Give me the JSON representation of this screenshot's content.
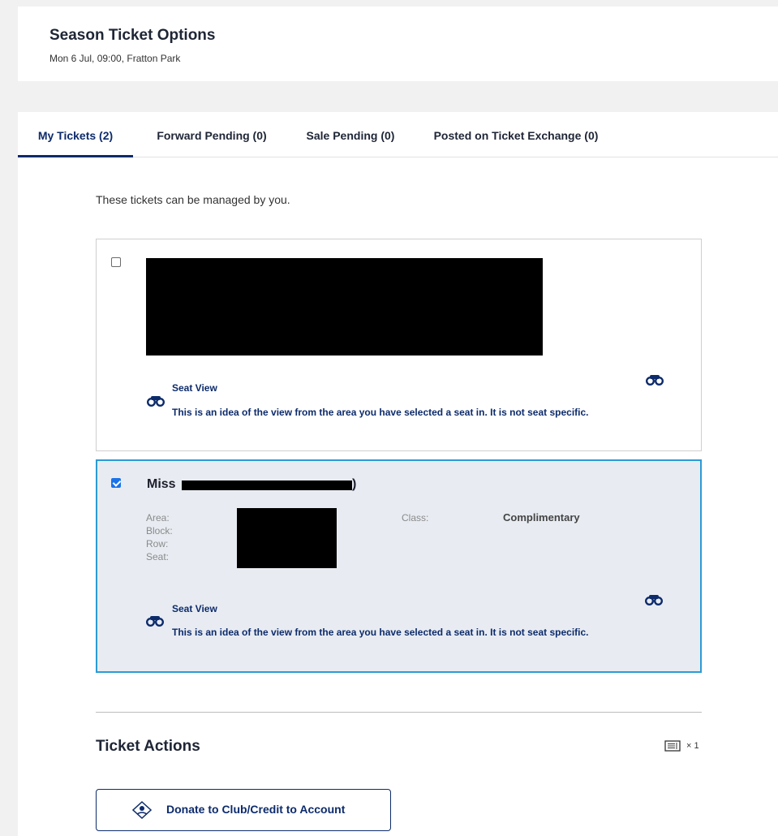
{
  "header": {
    "title": "Season Ticket Options",
    "subtitle": "Mon 6 Jul, 09:00, Fratton Park"
  },
  "tabs": [
    {
      "label": "My Tickets (2)",
      "active": true
    },
    {
      "label": "Forward Pending (0)",
      "active": false
    },
    {
      "label": "Sale Pending (0)",
      "active": false
    },
    {
      "label": "Posted on Ticket Exchange (0)",
      "active": false
    }
  ],
  "intro": "These tickets can be managed by you.",
  "tickets": [
    {
      "checked": false,
      "seat_view_title": "Seat View",
      "seat_view_desc": "This is an idea of the view from the area you have selected a seat in. It is not seat specific."
    },
    {
      "checked": true,
      "holder_prefix": "Miss",
      "holder_suffix": ")",
      "labels": {
        "area": "Area:",
        "block": "Block:",
        "row": "Row:",
        "seat": "Seat:"
      },
      "class_label": "Class:",
      "class_value": "Complimentary",
      "seat_view_title": "Seat View",
      "seat_view_desc": "This is an idea of the view from the area you have selected a seat in. It is not seat specific."
    }
  ],
  "ticket_actions": {
    "title": "Ticket Actions",
    "count": "× 1",
    "icon": "ticket-icon",
    "donate_label": "Donate to Club/Credit to Account"
  },
  "colors": {
    "accent": "#0d2b6b",
    "selected_border": "#2b9bd6",
    "selected_bg": "#e8ecf2"
  }
}
